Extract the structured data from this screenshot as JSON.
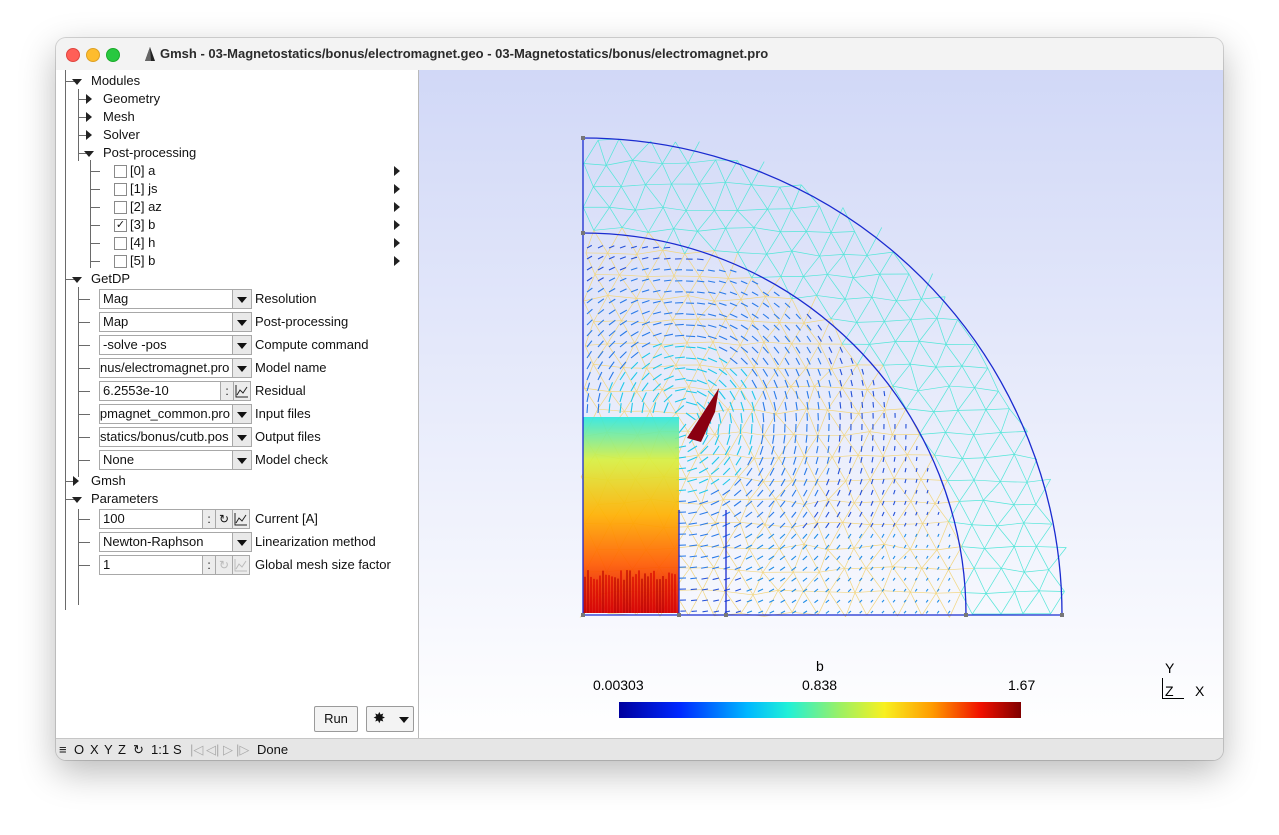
{
  "window": {
    "title": "Gmsh - 03-Magnetostatics/bonus/electromagnet.geo - 03-Magnetostatics/bonus/electromagnet.pro"
  },
  "tree": {
    "modules": "Modules",
    "geometry": "Geometry",
    "mesh": "Mesh",
    "solver": "Solver",
    "post_processing": "Post-processing",
    "views": [
      {
        "label": "[0] a",
        "checked": false
      },
      {
        "label": "[1] js",
        "checked": false
      },
      {
        "label": "[2] az",
        "checked": false
      },
      {
        "label": "[3] b",
        "checked": true
      },
      {
        "label": "[4] h",
        "checked": false
      },
      {
        "label": "[5] b",
        "checked": false
      }
    ],
    "getdp": "GetDP",
    "gmsh": "Gmsh",
    "parameters": "Parameters"
  },
  "getdp_fields": [
    {
      "value": "Mag",
      "label": "Resolution"
    },
    {
      "value": "Map",
      "label": "Post-processing"
    },
    {
      "value": "-solve -pos",
      "label": "Compute command"
    },
    {
      "value": "nus/electromagnet.pro",
      "label": "Model name"
    },
    {
      "value": "6.2553e-10",
      "label": "Residual"
    },
    {
      "value": "pmagnet_common.pro",
      "label": "Input files"
    },
    {
      "value": "statics/bonus/cutb.pos",
      "label": "Output files"
    },
    {
      "value": "None",
      "label": "Model check"
    }
  ],
  "param_fields": [
    {
      "value": "100",
      "label": "Current [A]"
    },
    {
      "value": "Newton-Raphson",
      "label": "Linearization method"
    },
    {
      "value": "1",
      "label": "Global mesh size factor"
    }
  ],
  "buttons": {
    "run": "Run",
    "gear_icon": "gear-icon",
    "colon": ":",
    "loop": "↻",
    "graph_icon": "graph-icon"
  },
  "colorbar": {
    "title": "b",
    "min": "0.00303",
    "mid": "0.838",
    "max": "1.67"
  },
  "axes": {
    "y": "Y",
    "z": "Z",
    "x": "X"
  },
  "status": {
    "menu_icon": "≡",
    "o": "O",
    "x": "X",
    "y": "Y",
    "z": "Z",
    "rotate_icon": "↻",
    "scale": "1:1",
    "s": "S",
    "nav_first": "|◁",
    "nav_prev": "◁|",
    "nav_next": "▷",
    "nav_last": "|▷",
    "message": "Done"
  }
}
